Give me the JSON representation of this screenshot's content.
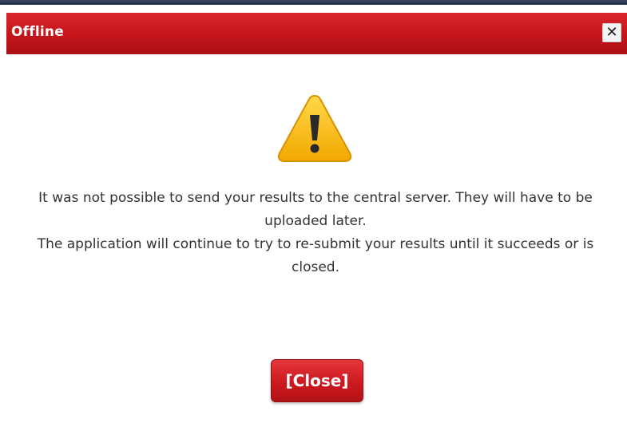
{
  "dialog": {
    "title": "Offline",
    "close_icon_glyph": "✕",
    "icon": "warning-icon",
    "message_line1": "It was not possible to send your results to the central server. They will have to be uploaded later.",
    "message_line2": "The application will continue to try to re-submit your results until it succeeds or is closed.",
    "close_button_label": "[Close]"
  },
  "colors": {
    "titlebar": "#c3151b",
    "button": "#c9171d",
    "warning": "#f5b400",
    "text": "#333333"
  }
}
